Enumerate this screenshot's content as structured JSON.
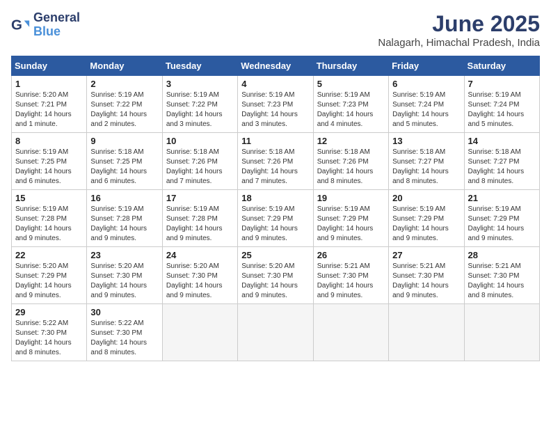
{
  "logo": {
    "line1": "General",
    "line2": "Blue"
  },
  "title": "June 2025",
  "location": "Nalagarh, Himachal Pradesh, India",
  "days_header": [
    "Sunday",
    "Monday",
    "Tuesday",
    "Wednesday",
    "Thursday",
    "Friday",
    "Saturday"
  ],
  "weeks": [
    [
      {
        "day": "1",
        "sunrise": "5:20 AM",
        "sunset": "7:21 PM",
        "daylight": "14 hours and 1 minute."
      },
      {
        "day": "2",
        "sunrise": "5:19 AM",
        "sunset": "7:22 PM",
        "daylight": "14 hours and 2 minutes."
      },
      {
        "day": "3",
        "sunrise": "5:19 AM",
        "sunset": "7:22 PM",
        "daylight": "14 hours and 3 minutes."
      },
      {
        "day": "4",
        "sunrise": "5:19 AM",
        "sunset": "7:23 PM",
        "daylight": "14 hours and 3 minutes."
      },
      {
        "day": "5",
        "sunrise": "5:19 AM",
        "sunset": "7:23 PM",
        "daylight": "14 hours and 4 minutes."
      },
      {
        "day": "6",
        "sunrise": "5:19 AM",
        "sunset": "7:24 PM",
        "daylight": "14 hours and 5 minutes."
      },
      {
        "day": "7",
        "sunrise": "5:19 AM",
        "sunset": "7:24 PM",
        "daylight": "14 hours and 5 minutes."
      }
    ],
    [
      {
        "day": "8",
        "sunrise": "5:19 AM",
        "sunset": "7:25 PM",
        "daylight": "14 hours and 6 minutes."
      },
      {
        "day": "9",
        "sunrise": "5:18 AM",
        "sunset": "7:25 PM",
        "daylight": "14 hours and 6 minutes."
      },
      {
        "day": "10",
        "sunrise": "5:18 AM",
        "sunset": "7:26 PM",
        "daylight": "14 hours and 7 minutes."
      },
      {
        "day": "11",
        "sunrise": "5:18 AM",
        "sunset": "7:26 PM",
        "daylight": "14 hours and 7 minutes."
      },
      {
        "day": "12",
        "sunrise": "5:18 AM",
        "sunset": "7:26 PM",
        "daylight": "14 hours and 8 minutes."
      },
      {
        "day": "13",
        "sunrise": "5:18 AM",
        "sunset": "7:27 PM",
        "daylight": "14 hours and 8 minutes."
      },
      {
        "day": "14",
        "sunrise": "5:18 AM",
        "sunset": "7:27 PM",
        "daylight": "14 hours and 8 minutes."
      }
    ],
    [
      {
        "day": "15",
        "sunrise": "5:19 AM",
        "sunset": "7:28 PM",
        "daylight": "14 hours and 9 minutes."
      },
      {
        "day": "16",
        "sunrise": "5:19 AM",
        "sunset": "7:28 PM",
        "daylight": "14 hours and 9 minutes."
      },
      {
        "day": "17",
        "sunrise": "5:19 AM",
        "sunset": "7:28 PM",
        "daylight": "14 hours and 9 minutes."
      },
      {
        "day": "18",
        "sunrise": "5:19 AM",
        "sunset": "7:29 PM",
        "daylight": "14 hours and 9 minutes."
      },
      {
        "day": "19",
        "sunrise": "5:19 AM",
        "sunset": "7:29 PM",
        "daylight": "14 hours and 9 minutes."
      },
      {
        "day": "20",
        "sunrise": "5:19 AM",
        "sunset": "7:29 PM",
        "daylight": "14 hours and 9 minutes."
      },
      {
        "day": "21",
        "sunrise": "5:19 AM",
        "sunset": "7:29 PM",
        "daylight": "14 hours and 9 minutes."
      }
    ],
    [
      {
        "day": "22",
        "sunrise": "5:20 AM",
        "sunset": "7:29 PM",
        "daylight": "14 hours and 9 minutes."
      },
      {
        "day": "23",
        "sunrise": "5:20 AM",
        "sunset": "7:30 PM",
        "daylight": "14 hours and 9 minutes."
      },
      {
        "day": "24",
        "sunrise": "5:20 AM",
        "sunset": "7:30 PM",
        "daylight": "14 hours and 9 minutes."
      },
      {
        "day": "25",
        "sunrise": "5:20 AM",
        "sunset": "7:30 PM",
        "daylight": "14 hours and 9 minutes."
      },
      {
        "day": "26",
        "sunrise": "5:21 AM",
        "sunset": "7:30 PM",
        "daylight": "14 hours and 9 minutes."
      },
      {
        "day": "27",
        "sunrise": "5:21 AM",
        "sunset": "7:30 PM",
        "daylight": "14 hours and 9 minutes."
      },
      {
        "day": "28",
        "sunrise": "5:21 AM",
        "sunset": "7:30 PM",
        "daylight": "14 hours and 8 minutes."
      }
    ],
    [
      {
        "day": "29",
        "sunrise": "5:22 AM",
        "sunset": "7:30 PM",
        "daylight": "14 hours and 8 minutes."
      },
      {
        "day": "30",
        "sunrise": "5:22 AM",
        "sunset": "7:30 PM",
        "daylight": "14 hours and 8 minutes."
      },
      null,
      null,
      null,
      null,
      null
    ]
  ],
  "labels": {
    "sunrise": "Sunrise:",
    "sunset": "Sunset:",
    "daylight": "Daylight:"
  }
}
